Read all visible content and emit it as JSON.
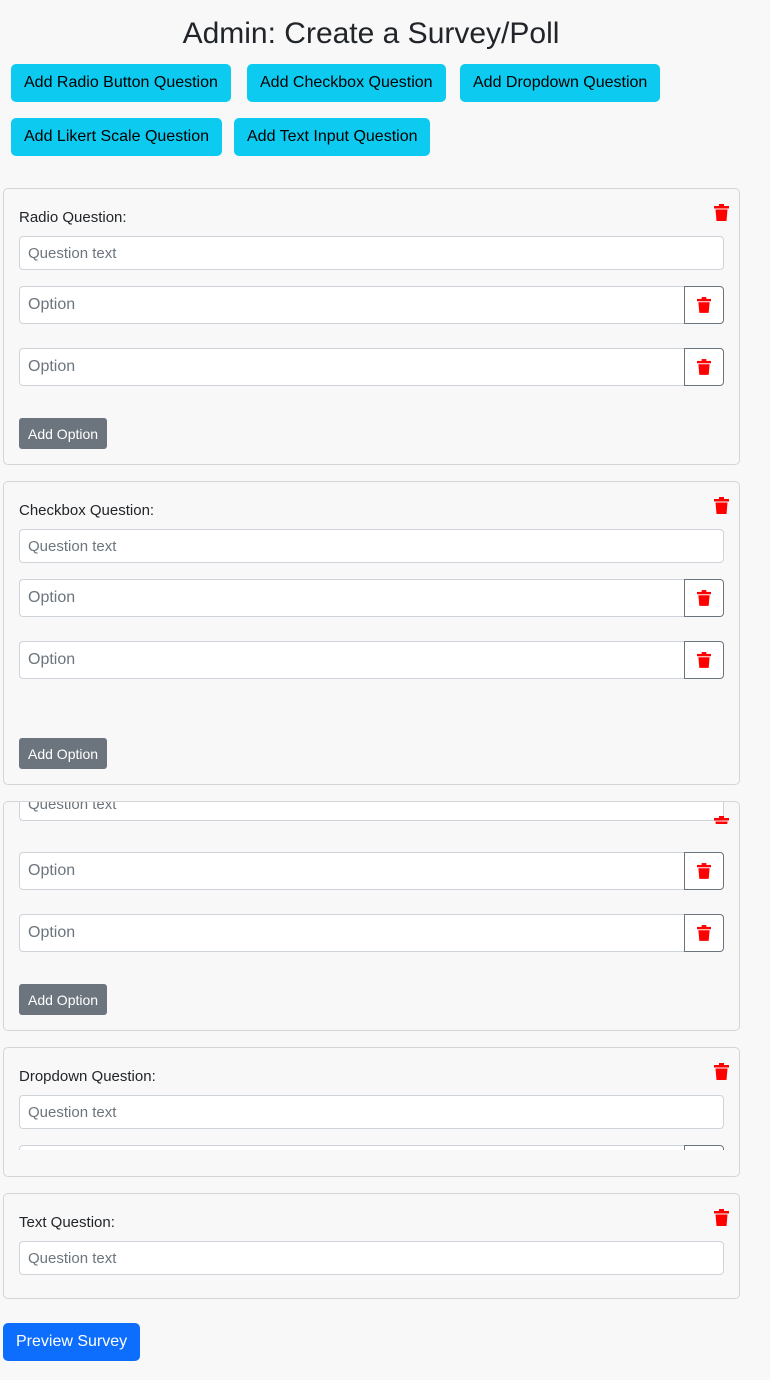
{
  "page": {
    "title": "Admin: Create a Survey/Poll"
  },
  "toolbar": {
    "add_radio": "Add Radio Button Question",
    "add_checkbox": "Add Checkbox Question",
    "add_dropdown": "Add Dropdown Question",
    "add_likert": "Add Likert Scale Question",
    "add_text": "Add Text Input Question"
  },
  "questions": {
    "radio": {
      "label": "Radio Question:",
      "text_placeholder": "Question text",
      "options": [
        {
          "placeholder": "Option"
        },
        {
          "placeholder": "Option"
        }
      ],
      "add_option": "Add Option"
    },
    "checkbox": {
      "label": "Checkbox Question:",
      "text_placeholder": "Question text",
      "options": [
        {
          "placeholder": "Option"
        },
        {
          "placeholder": "Option"
        }
      ],
      "add_option": "Add Option"
    },
    "scrolled": {
      "text_placeholder": "Question text",
      "options": [
        {
          "placeholder": "Option"
        },
        {
          "placeholder": "Option"
        }
      ],
      "add_option": "Add Option"
    },
    "dropdown": {
      "label": "Dropdown Question:",
      "text_placeholder": "Question text"
    },
    "text": {
      "label": "Text Question:",
      "text_placeholder": "Question text"
    }
  },
  "footer": {
    "preview": "Preview Survey"
  },
  "colors": {
    "info_button": "#0dcaf0",
    "secondary_button": "#6c757d",
    "primary_button": "#0d6efd",
    "delete_icon": "#ff0000"
  },
  "icons": {
    "delete": "trash-icon"
  }
}
